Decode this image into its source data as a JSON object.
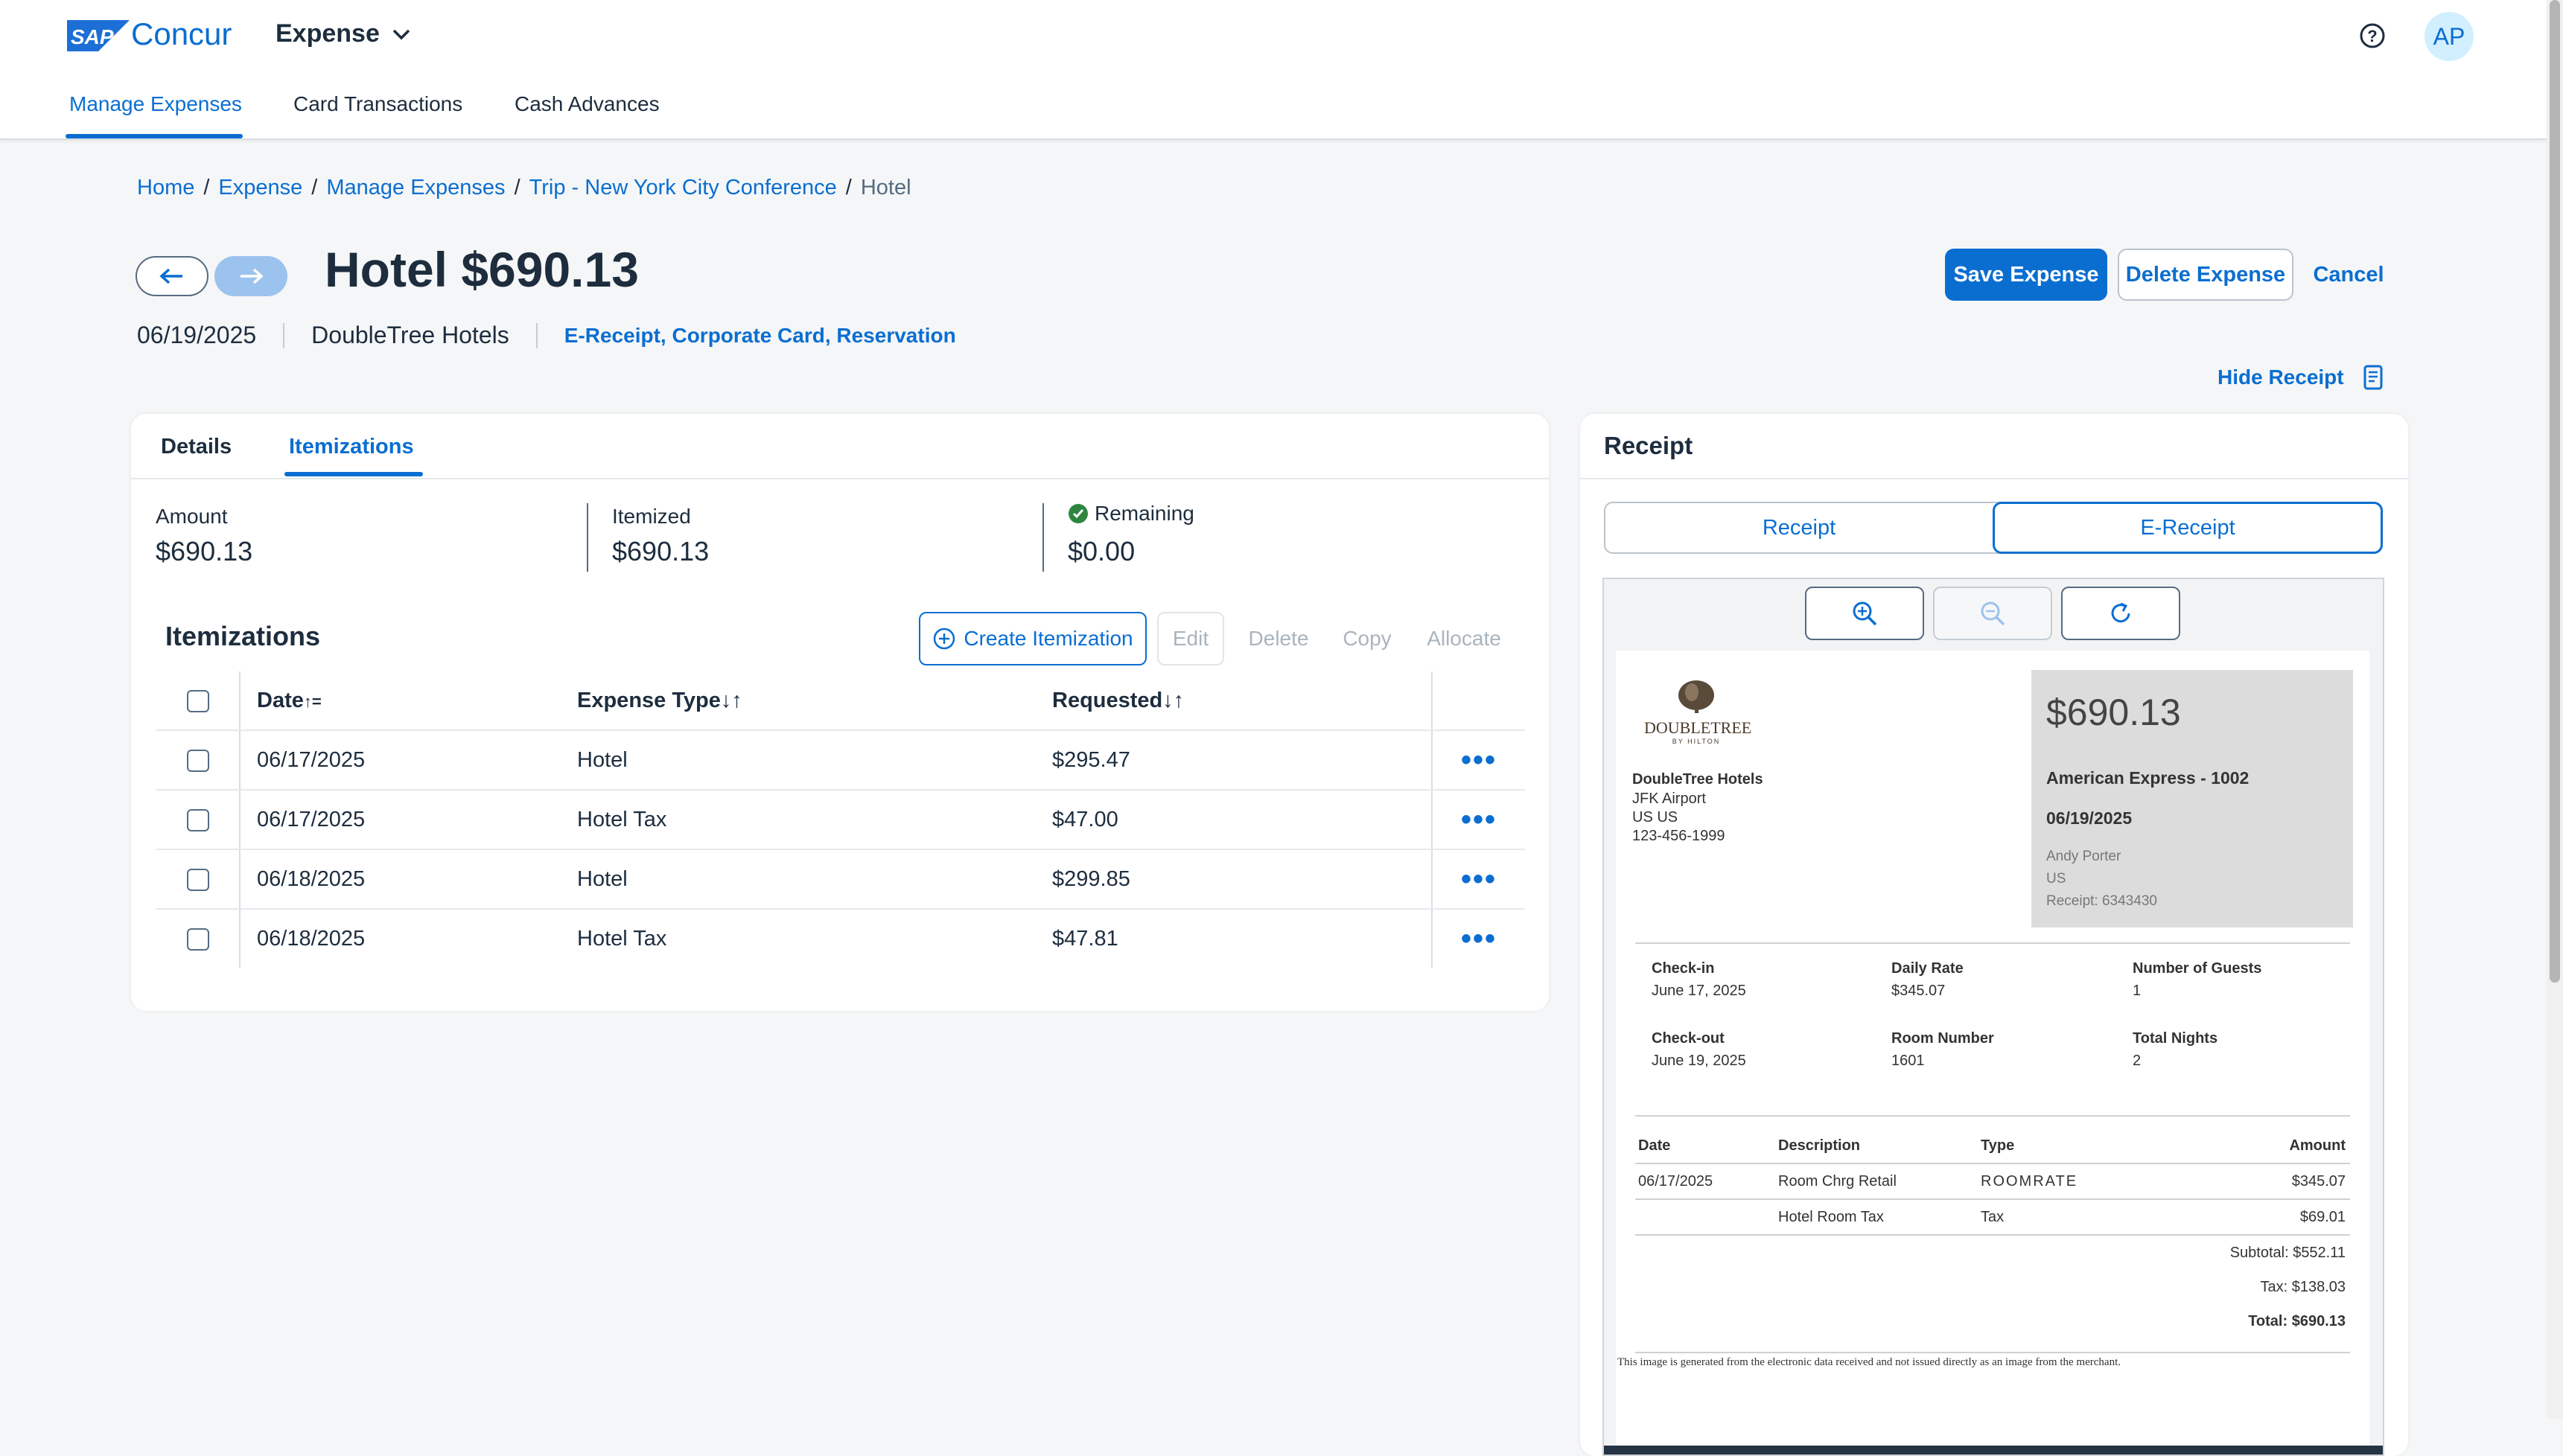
{
  "header": {
    "brand": "Concur",
    "logo_text": "SAP",
    "app_name": "Expense",
    "avatar_initials": "AP"
  },
  "nav_tabs": [
    "Manage Expenses",
    "Card Transactions",
    "Cash Advances"
  ],
  "breadcrumb": {
    "links": [
      "Home",
      "Expense",
      "Manage Expenses",
      "Trip - New York City Conference"
    ],
    "current": "Hotel",
    "separator": "/"
  },
  "expense": {
    "title": "Hotel $690.13",
    "date": "06/19/2025",
    "vendor": "DoubleTree Hotels",
    "tags": "E-Receipt, Corporate Card, Reservation"
  },
  "actions": {
    "save": "Save Expense",
    "delete": "Delete Expense",
    "cancel": "Cancel",
    "hide_receipt": "Hide Receipt"
  },
  "left_card": {
    "tabs": [
      "Details",
      "Itemizations"
    ],
    "active_tab": "Itemizations",
    "summary": {
      "amount_label": "Amount",
      "amount": "$690.13",
      "itemized_label": "Itemized",
      "itemized": "$690.13",
      "remaining_label": "Remaining",
      "remaining": "$0.00"
    },
    "section_title": "Itemizations",
    "toolbar": {
      "create": "Create Itemization",
      "edit": "Edit",
      "delete": "Delete",
      "copy": "Copy",
      "allocate": "Allocate"
    },
    "columns": [
      "Date",
      "Expense Type",
      "Requested"
    ],
    "rows": [
      {
        "date": "06/17/2025",
        "type": "Hotel",
        "amount": "$295.47"
      },
      {
        "date": "06/17/2025",
        "type": "Hotel Tax",
        "amount": "$47.00"
      },
      {
        "date": "06/18/2025",
        "type": "Hotel",
        "amount": "$299.85"
      },
      {
        "date": "06/18/2025",
        "type": "Hotel Tax",
        "amount": "$47.81"
      }
    ]
  },
  "receipt": {
    "title": "Receipt",
    "tabs": [
      "Receipt",
      "E-Receipt"
    ],
    "active_tab": "E-Receipt",
    "logo_text": "DOUBLETREE",
    "logo_sub": "BY HILTON",
    "merchant": {
      "name": "DoubleTree Hotels",
      "line1": "JFK Airport",
      "line2": "US US",
      "phone": "123-456-1999"
    },
    "total": "$690.13",
    "card": "American Express - 1002",
    "date": "06/19/2025",
    "guest_name": "Andy Porter",
    "guest_country": "US",
    "receipt_no": "Receipt: 6343430",
    "stay": {
      "checkin_label": "Check-in",
      "checkin": "June 17, 2025",
      "rate_label": "Daily Rate",
      "rate": "$345.07",
      "guests_label": "Number of Guests",
      "guests": "1",
      "checkout_label": "Check-out",
      "checkout": "June 19, 2025",
      "room_label": "Room Number",
      "room": "1601",
      "nights_label": "Total Nights",
      "nights": "2"
    },
    "lines_header": [
      "Date",
      "Description",
      "Type",
      "Amount"
    ],
    "lines": [
      {
        "date": "06/17/2025",
        "desc": "Room Chrg Retail",
        "type": "ROOMRATE",
        "amount": "$345.07"
      },
      {
        "date": "",
        "desc": "Hotel Room Tax",
        "type": "Tax",
        "amount": "$69.01"
      }
    ],
    "subtotal": "Subtotal: $552.11",
    "tax": "Tax: $138.03",
    "grand_total": "Total: $690.13",
    "disclaimer": "This image is generated from the electronic data received and not issued directly as an image from the merchant."
  },
  "colors": {
    "accent": "#0a6ed1",
    "text": "#1d2d3e",
    "success": "#2e8540"
  }
}
